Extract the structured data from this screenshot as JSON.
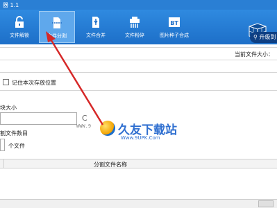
{
  "window": {
    "title": "器 1.1"
  },
  "toolbar": {
    "items": [
      {
        "label": "文件解锁",
        "icon": "lock-icon"
      },
      {
        "label": "文件分割",
        "icon": "document-split-icon",
        "active": true
      },
      {
        "label": "文件合并",
        "icon": "document-merge-icon"
      },
      {
        "label": "文件粉碎",
        "icon": "shredder-icon"
      },
      {
        "label": "图片种子合成",
        "icon": "bt-icon",
        "icon_text": "BT"
      }
    ],
    "upgrade_label": "升级到",
    "accent": "#1d6fc8"
  },
  "main": {
    "current_size_label": "当前文件大小：",
    "remember_label": "记住本次存放位置",
    "size_label": "块大小",
    "size_unit": "C",
    "count_label": "割文件数目",
    "count_unit": "个文件",
    "table_header": "分割文件名称"
  },
  "watermark": {
    "host": "WWW.9",
    "brand": "久友下载站",
    "url": "Www.9UPK.Com"
  }
}
